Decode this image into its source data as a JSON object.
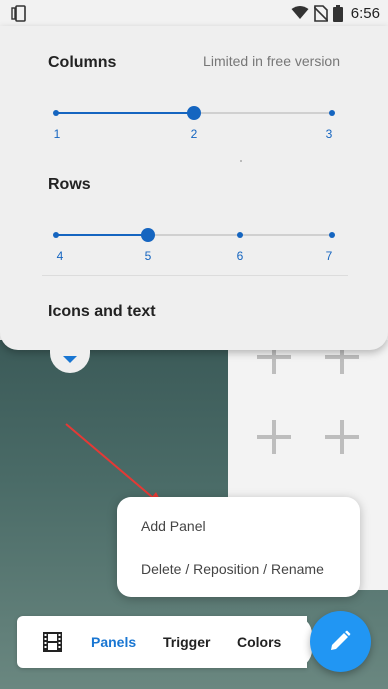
{
  "status_bar": {
    "time": "6:56",
    "icons": [
      "wifi-icon",
      "no-sim-icon",
      "battery-icon"
    ],
    "left_icon": "app-switch-icon"
  },
  "settings_card": {
    "columns": {
      "title": "Columns",
      "note": "Limited in free version",
      "ticks": [
        "1",
        "2",
        "3"
      ],
      "selected": "2"
    },
    "rows": {
      "title": "Rows",
      "ticks": [
        "4",
        "5",
        "6",
        "7"
      ],
      "selected": "5"
    },
    "icons_text": {
      "title": "Icons and text"
    },
    "accent": "#1565c0"
  },
  "popup_menu": {
    "items": [
      "Add Panel",
      "Delete / Reposition / Rename"
    ]
  },
  "bottom_bar": {
    "tabs": [
      "Panels",
      "Trigger",
      "Colors"
    ],
    "active_tab": "Panels",
    "left_icon": "film-icon"
  },
  "fab": {
    "icon": "pencil-icon",
    "color": "#2196f3"
  },
  "annotation": {
    "arrow_color": "#e53935"
  }
}
